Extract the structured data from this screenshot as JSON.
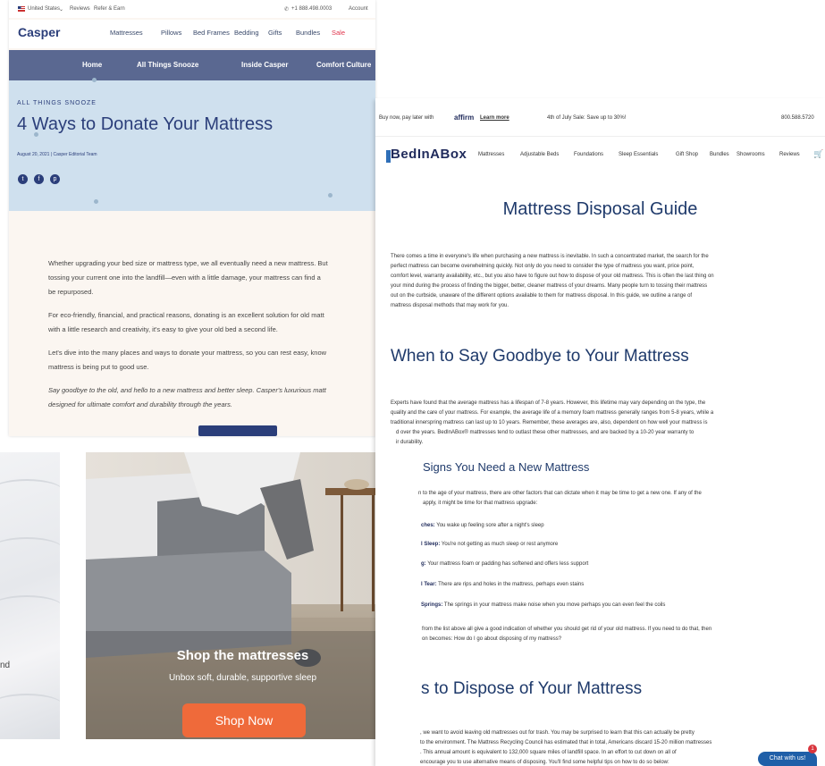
{
  "casper": {
    "utility": {
      "country": "United States",
      "reviews": "Reviews",
      "refer": "Refer & Earn",
      "phone": "+1 888.498.0003",
      "account": "Account"
    },
    "logo": "Casper",
    "nav": [
      "Mattresses",
      "Pillows",
      "Bed Frames",
      "Bedding",
      "Gifts",
      "Bundles",
      "Sale"
    ],
    "subnav": [
      "Home",
      "All Things Snooze",
      "Inside Casper",
      "Comfort Culture"
    ],
    "kicker": "ALL THINGS SNOOZE",
    "title": "4 Ways to Donate Your Mattress",
    "meta": "August 20, 2021 | Casper Editorial Team",
    "body": [
      "Whether upgrading your bed size or mattress type, we all eventually need a new mattress. But",
      "tossing your current one into the landfill—even with a little damage, your mattress can find a",
      "be repurposed.",
      "For eco-friendly, financial, and practical reasons, donating is an excellent solution for old matt",
      "with a little research and creativity, it's easy to give your old bed a second life.",
      "Let's dive into the many places and ways to donate your mattress, so you can rest easy, know",
      "mattress is being put to good use.",
      "Say goodbye to the old, and hello to a new mattress and better sleep. Casper's luxurious matt",
      "designed for ultimate comfort and durability through the years."
    ]
  },
  "bib": {
    "promo": {
      "buy_now": "Buy now, pay later with",
      "affirm": "affirm",
      "learn_more": "Learn more",
      "sale": "4th of July Sale: Save up to 30%!",
      "phone": "800.588.5720"
    },
    "logo": "BedInABox",
    "nav": [
      "Mattresses",
      "Adjustable Beds",
      "Foundations",
      "Sleep Essentials",
      "Gift Shop",
      "Bundles",
      "Showrooms",
      "Reviews"
    ],
    "h1": "Mattress Disposal Guide",
    "intro": [
      "There comes a time in everyone's life when purchasing a new mattress is inevitable. In such a concentrated market, the search for the",
      "perfect mattress can become overwhelming quickly. Not only do you need to consider the type of mattress you want, price point,",
      "comfort level, warranty availability, etc., but you also have to figure out how to dispose of your old mattress. This is often the last thing on",
      "your mind during the process of finding the bigger, better, cleaner mattress of your dreams. Many people turn to tossing their mattress",
      "out on the curbside, unaware of the different options available to them for mattress disposal. In this guide, we outline a range of",
      "mattress disposal methods that may work for you."
    ],
    "h2_goodbye": "When to Say Goodbye to Your Mattress",
    "goodbye": [
      "Experts have found that the average mattress has a lifespan of 7-8 years. However, this lifetime may vary depending on the type, the",
      "quality and the care of your mattress. For example, the average life of a memory foam mattress generally ranges from 5-8 years, while a",
      "traditional innerspring mattress can last up to 10 years. Remember, these averages are, also, dependent on how well your mattress is",
      "d over the years. BedInABox® mattresses tend to outlast these other mattresses, and are backed by a 10-20 year warranty to",
      "ir durability."
    ],
    "h3_signs": "Signs You Need a New Mattress",
    "signs_intro": [
      "n to the age of your mattress, there are other factors that can dictate when it may be time to get a new one. If any of the",
      "apply, it might be time for that mattress upgrade:"
    ],
    "signs": [
      {
        "label": "ches:",
        "text": " You wake up feeling sore after a night's sleep"
      },
      {
        "label": "l Sleep:",
        "text": " You're not getting as much sleep or rest anymore"
      },
      {
        "label": "g:",
        "text": " Your mattress foam or padding has softened and offers less support"
      },
      {
        "label": "l Tear:",
        "text": " There are rips and holes in the mattress, perhaps even stains"
      },
      {
        "label": "Springs:",
        "text": " The springs in your mattress make noise when you move perhaps you can even feel the coils"
      }
    ],
    "signs_outro": [
      "from the list above all give a good indication of whether you should get rid of your old mattress. If you need to do that, then",
      "on becomes: How do I go about disposing of my mattress?"
    ],
    "h2_dispose": "s to Dispose of Your Mattress",
    "dispose": [
      ", we want to avoid leaving old mattresses out for trash. You may be surprised to learn that this can actually be pretty",
      "to the environment. The Mattress Recycling Council has estimated that in total, Americans discard 15-20 million mattresses",
      ". This annual amount is equivalent to 132,000 square miles of landfill space. In an effort to cut down on all of",
      "encourage you to use alternative means of disposing. You'll find some helpful tips on how to do so below:"
    ],
    "chat": "Chat with us!",
    "chat_badge": "1"
  },
  "photo1": {
    "text": "nd"
  },
  "photo2": {
    "title": "Shop the mattresses",
    "subtitle": "Unbox soft, durable, supportive sleep",
    "button": "Shop Now"
  }
}
